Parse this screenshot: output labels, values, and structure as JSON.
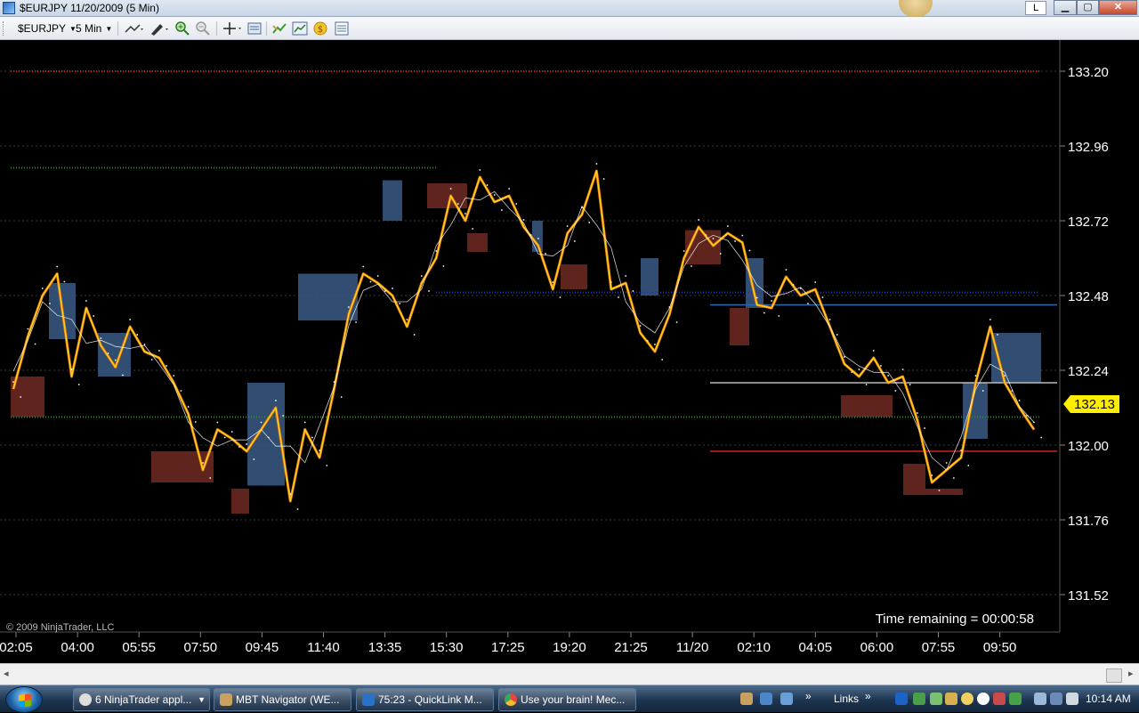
{
  "window": {
    "title": "$EURJPY  11/20/2009 (5 Min)",
    "l_button": "L",
    "minimize": "▁",
    "maximize": "▢",
    "close": "✕"
  },
  "toolbar": {
    "instrument": "$EURJPY",
    "interval": "5 Min",
    "icons": [
      "line-style-icon",
      "draw-pen-icon",
      "zoom-in-icon",
      "zoom-out-icon",
      "crosshair-icon",
      "data-box-icon",
      "chart-trader-icon",
      "indicators-icon",
      "strategy-icon",
      "properties-icon"
    ]
  },
  "chart": {
    "copyright": "© 2009 NinjaTrader, LLC",
    "time_remaining": "Time remaining = 00:00:58",
    "last_price": "132.13",
    "price_ticks": [
      "133.20",
      "132.96",
      "132.72",
      "132.48",
      "132.24",
      "132.00",
      "131.76",
      "131.52"
    ],
    "time_ticks": [
      "02:05",
      "04:00",
      "05:55",
      "07:50",
      "09:45",
      "11:40",
      "13:35",
      "15:30",
      "17:25",
      "19:20",
      "21:25",
      "11/20",
      "02:10",
      "04:05",
      "06:00",
      "07:55",
      "09:50"
    ],
    "colors": {
      "price_line": "#ffd21a",
      "bull_box": "#3b5a86",
      "bear_box": "#6e2a22",
      "last_price_tag": "#ffee00",
      "resistance": "#cc2020",
      "support_green": "#2a8a2a",
      "pivot_blue": "#2a6ab0"
    }
  },
  "chart_data": {
    "type": "line",
    "ylim": [
      131.44,
      133.28
    ],
    "yticks": [
      133.2,
      132.96,
      132.72,
      132.48,
      132.24,
      132.0,
      131.76,
      131.52
    ],
    "xlabels": [
      "02:05",
      "04:00",
      "05:55",
      "07:50",
      "09:45",
      "11:40",
      "13:35",
      "15:30",
      "17:25",
      "19:20",
      "21:25",
      "11/20",
      "02:10",
      "04:05",
      "06:00",
      "07:55",
      "09:50"
    ],
    "last_price": 132.13,
    "grid": true,
    "series": [
      {
        "values": [
          132.18,
          132.35,
          132.48,
          132.55,
          132.22,
          132.44,
          132.32,
          132.25,
          132.38,
          132.3,
          132.28,
          132.2,
          132.1,
          131.92,
          132.05,
          132.02,
          131.98,
          132.05,
          132.12,
          131.82,
          132.05,
          131.96,
          132.18,
          132.42,
          132.55,
          132.52,
          132.48,
          132.38,
          132.52,
          132.6,
          132.8,
          132.72,
          132.86,
          132.78,
          132.8,
          132.7,
          132.64,
          132.5,
          132.68,
          132.74,
          132.88,
          132.5,
          132.52,
          132.36,
          132.3,
          132.42,
          132.6,
          132.7,
          132.64,
          132.68,
          132.65,
          132.45,
          132.44,
          132.54,
          132.48,
          132.5,
          132.38,
          132.26,
          132.22,
          132.28,
          132.2,
          132.22,
          132.08,
          131.88,
          131.92,
          131.96,
          132.2,
          132.38,
          132.2,
          132.12,
          132.05
        ]
      }
    ],
    "horizontal_levels": [
      133.2,
      132.89,
      132.49,
      132.45,
      132.2,
      132.09,
      131.98
    ]
  },
  "hscroll": {
    "left_arrow": "◂",
    "right_arrow": "▸"
  },
  "taskbar": {
    "tasks": [
      "6 NinjaTrader appl...",
      "MBT Navigator (WE...",
      "75:23 - QuickLink M...",
      "Use your brain! Mec..."
    ],
    "links": "Links",
    "chevron": "»",
    "clock": "10:14 AM"
  }
}
